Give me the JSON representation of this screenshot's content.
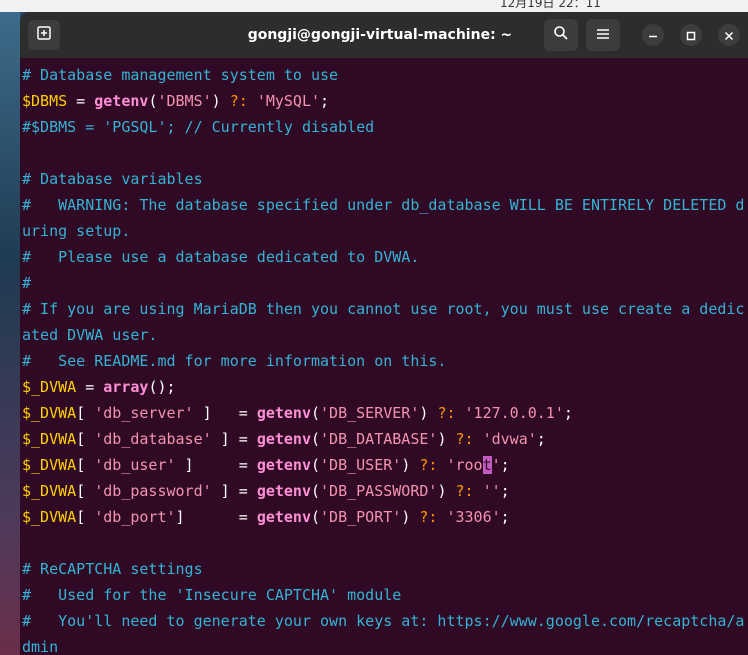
{
  "topbar": {
    "clock": "12月19日 22：11"
  },
  "window": {
    "title": "gongji@gongji-virtual-machine: ~"
  },
  "icons": {
    "new_tab": "new-tab-icon",
    "search": "search-icon",
    "menu": "hamburger-menu-icon",
    "minimize": "minimize-icon",
    "maximize": "maximize-icon",
    "close": "close-icon"
  },
  "colors": {
    "terminal_bg": "#300a24",
    "comment": "#34b3d6",
    "variable": "#ffd000",
    "function": "#ff8fd6",
    "string": "#f392b0",
    "operator": "#ff9500",
    "cursor": "#c45bc4"
  },
  "lines": [
    [
      {
        "c": "t-comment",
        "t": "# Database management system to use"
      }
    ],
    [
      {
        "c": "t-var",
        "t": "$DBMS"
      },
      {
        "c": "t-plain",
        "t": " = "
      },
      {
        "c": "t-func",
        "t": "getenv"
      },
      {
        "c": "t-plain",
        "t": "("
      },
      {
        "c": "t-str",
        "t": "'DBMS'"
      },
      {
        "c": "t-plain",
        "t": ") "
      },
      {
        "c": "t-op",
        "t": "?:"
      },
      {
        "c": "t-plain",
        "t": " "
      },
      {
        "c": "t-str",
        "t": "'MySQL'"
      },
      {
        "c": "t-plain",
        "t": ";"
      }
    ],
    [
      {
        "c": "t-comment",
        "t": "#$DBMS = 'PGSQL'; // Currently disabled"
      }
    ],
    [
      {
        "c": "t-plain",
        "t": ""
      }
    ],
    [
      {
        "c": "t-comment",
        "t": "# Database variables"
      }
    ],
    [
      {
        "c": "t-comment",
        "t": "#   WARNING: The database specified under db_database WILL BE ENTIRELY DELETED d"
      }
    ],
    [
      {
        "c": "t-comment",
        "t": "uring setup."
      }
    ],
    [
      {
        "c": "t-comment",
        "t": "#   Please use a database dedicated to DVWA."
      }
    ],
    [
      {
        "c": "t-comment",
        "t": "#"
      }
    ],
    [
      {
        "c": "t-comment",
        "t": "# If you are using MariaDB then you cannot use root, you must use create a dedic"
      }
    ],
    [
      {
        "c": "t-comment",
        "t": "ated DVWA user."
      }
    ],
    [
      {
        "c": "t-comment",
        "t": "#   See README.md for more information on this."
      }
    ],
    [
      {
        "c": "t-var",
        "t": "$_DVWA"
      },
      {
        "c": "t-plain",
        "t": " = "
      },
      {
        "c": "t-func",
        "t": "array"
      },
      {
        "c": "t-plain",
        "t": "();"
      }
    ],
    [
      {
        "c": "t-var",
        "t": "$_DVWA"
      },
      {
        "c": "t-plain",
        "t": "[ "
      },
      {
        "c": "t-str",
        "t": "'db_server'"
      },
      {
        "c": "t-plain",
        "t": " ]   = "
      },
      {
        "c": "t-func",
        "t": "getenv"
      },
      {
        "c": "t-plain",
        "t": "("
      },
      {
        "c": "t-str",
        "t": "'DB_SERVER'"
      },
      {
        "c": "t-plain",
        "t": ") "
      },
      {
        "c": "t-op",
        "t": "?:"
      },
      {
        "c": "t-plain",
        "t": " "
      },
      {
        "c": "t-str",
        "t": "'127.0.0.1'"
      },
      {
        "c": "t-plain",
        "t": ";"
      }
    ],
    [
      {
        "c": "t-var",
        "t": "$_DVWA"
      },
      {
        "c": "t-plain",
        "t": "[ "
      },
      {
        "c": "t-str",
        "t": "'db_database'"
      },
      {
        "c": "t-plain",
        "t": " ] = "
      },
      {
        "c": "t-func",
        "t": "getenv"
      },
      {
        "c": "t-plain",
        "t": "("
      },
      {
        "c": "t-str",
        "t": "'DB_DATABASE'"
      },
      {
        "c": "t-plain",
        "t": ") "
      },
      {
        "c": "t-op",
        "t": "?:"
      },
      {
        "c": "t-plain",
        "t": " "
      },
      {
        "c": "t-str",
        "t": "'dvwa'"
      },
      {
        "c": "t-plain",
        "t": ";"
      }
    ],
    [
      {
        "c": "t-var",
        "t": "$_DVWA"
      },
      {
        "c": "t-plain",
        "t": "[ "
      },
      {
        "c": "t-str",
        "t": "'db_user'"
      },
      {
        "c": "t-plain",
        "t": " ]     = "
      },
      {
        "c": "t-func",
        "t": "getenv"
      },
      {
        "c": "t-plain",
        "t": "("
      },
      {
        "c": "t-str",
        "t": "'DB_USER'"
      },
      {
        "c": "t-plain",
        "t": ") "
      },
      {
        "c": "t-op",
        "t": "?:"
      },
      {
        "c": "t-plain",
        "t": " "
      },
      {
        "c": "t-str",
        "t": "'roo"
      },
      {
        "c": "cursor",
        "t": "t"
      },
      {
        "c": "t-str",
        "t": "'"
      },
      {
        "c": "t-plain",
        "t": ";"
      }
    ],
    [
      {
        "c": "t-var",
        "t": "$_DVWA"
      },
      {
        "c": "t-plain",
        "t": "[ "
      },
      {
        "c": "t-str",
        "t": "'db_password'"
      },
      {
        "c": "t-plain",
        "t": " ] = "
      },
      {
        "c": "t-func",
        "t": "getenv"
      },
      {
        "c": "t-plain",
        "t": "("
      },
      {
        "c": "t-str",
        "t": "'DB_PASSWORD'"
      },
      {
        "c": "t-plain",
        "t": ") "
      },
      {
        "c": "t-op",
        "t": "?:"
      },
      {
        "c": "t-plain",
        "t": " "
      },
      {
        "c": "t-str",
        "t": "''"
      },
      {
        "c": "t-plain",
        "t": ";"
      }
    ],
    [
      {
        "c": "t-var",
        "t": "$_DVWA"
      },
      {
        "c": "t-plain",
        "t": "[ "
      },
      {
        "c": "t-str",
        "t": "'db_port'"
      },
      {
        "c": "t-plain",
        "t": "]      = "
      },
      {
        "c": "t-func",
        "t": "getenv"
      },
      {
        "c": "t-plain",
        "t": "("
      },
      {
        "c": "t-str",
        "t": "'DB_PORT'"
      },
      {
        "c": "t-plain",
        "t": ") "
      },
      {
        "c": "t-op",
        "t": "?:"
      },
      {
        "c": "t-plain",
        "t": " "
      },
      {
        "c": "t-str",
        "t": "'3306'"
      },
      {
        "c": "t-plain",
        "t": ";"
      }
    ],
    [
      {
        "c": "t-plain",
        "t": ""
      }
    ],
    [
      {
        "c": "t-comment",
        "t": "# ReCAPTCHA settings"
      }
    ],
    [
      {
        "c": "t-comment",
        "t": "#   Used for the 'Insecure CAPTCHA' module"
      }
    ],
    [
      {
        "c": "t-comment",
        "t": "#   You'll need to generate your own keys at: https://www.google.com/recaptcha/a"
      }
    ],
    [
      {
        "c": "t-comment",
        "t": "dmin"
      }
    ]
  ]
}
